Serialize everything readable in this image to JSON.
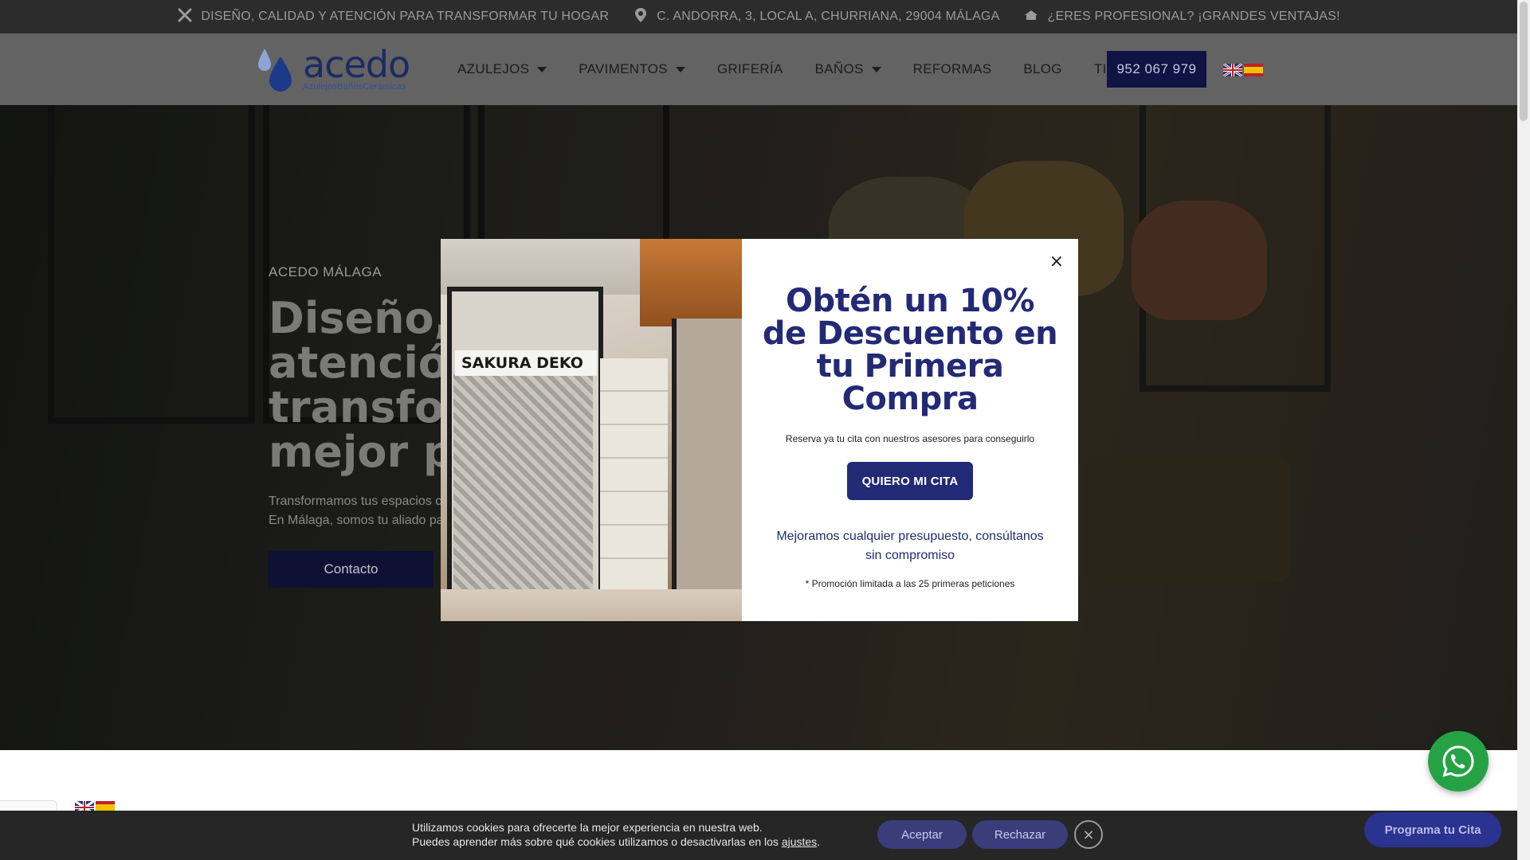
{
  "topbar": {
    "items": [
      {
        "icon": "tools-icon",
        "text": "DISEÑO, CALIDAD Y ATENCIÓN PARA TRANSFORMAR TU HOGAR"
      },
      {
        "icon": "map-pin-icon",
        "text": "C. ANDORRA, 3, LOCAL A, CHURRIANA, 29004 MÁLAGA"
      },
      {
        "icon": "building-icon",
        "text": "¿ERES PROFESIONAL? ¡GRANDES VENTAJAS!"
      }
    ]
  },
  "header": {
    "logo_brand": "acedo",
    "logo_tagline": "AzulejosBañosCerámicas",
    "nav": [
      {
        "label": "AZULEJOS",
        "dropdown": true
      },
      {
        "label": "PAVIMENTOS",
        "dropdown": true
      },
      {
        "label": "GRIFERÍA",
        "dropdown": false
      },
      {
        "label": "BAÑOS",
        "dropdown": true
      },
      {
        "label": "REFORMAS",
        "dropdown": false
      },
      {
        "label": "BLOG",
        "dropdown": false
      },
      {
        "label": "TIENDA",
        "dropdown": false
      }
    ],
    "phone": "952 067 979",
    "languages": [
      "en-flag-icon",
      "es-flag-icon"
    ]
  },
  "hero": {
    "kicker": "ACEDO MÁLAGA",
    "title_lines": [
      "Diseño, c",
      "atención",
      "transform",
      "mejor pr"
    ],
    "sub_lines": [
      "Transformamos tus espacios con",
      "En Málaga, somos tu aliado par"
    ],
    "button": "Contacto"
  },
  "modal": {
    "photo_label": "SAKURA DEKO",
    "title": "Obtén un 10% de Descuento en tu Primera Compra",
    "subtitle": "Reserva ya tu cita con nuestros asesores para conseguirlo",
    "cta": "QUIERO MI CITA",
    "promo": "Mejoramos cualquier presupuesto, consúltanos sin compromiso",
    "note": "* Promoción limitada a las 25 primeras peticiones",
    "close": "×"
  },
  "cookie": {
    "line1": "Utilizamos cookies para ofrecerte la mejor experiencia en nuestra web.",
    "line2_pre": "Puedes aprender más sobre qué cookies utilizamos o desactivarlas en los ",
    "line2_link": "ajustes",
    "line2_post": ".",
    "accept": "Aceptar",
    "reject": "Rechazar",
    "close": "×"
  },
  "floating": {
    "schedule": "Programa tu Cita"
  },
  "colors": {
    "brand_navy": "#232a75",
    "dark_navy": "#0f1444",
    "whatsapp": "#25a244"
  }
}
